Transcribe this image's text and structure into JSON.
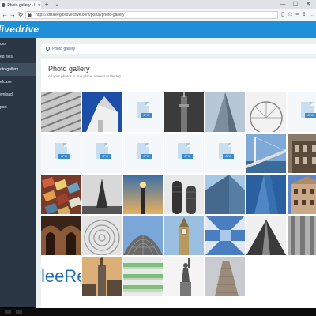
{
  "browser": {
    "tab_title": "Photo gallery - Livedrive",
    "tab_close": "✕",
    "new_tab": "+",
    "tab_menu": "⌄",
    "url": "https://dtzaeeglbi.livedrive.com/portal/photo-gallery",
    "nav": {
      "back": "←",
      "forward": "→",
      "refresh": "↻"
    },
    "window_controls": {
      "minimize": "—",
      "maximize": "☐",
      "close": "✕"
    },
    "toolbar_icons": [
      "reading-view-icon",
      "favorite-star-icon",
      "favorites-icon",
      "notes-icon",
      "share-icon",
      "more-icon"
    ]
  },
  "app": {
    "logo": "livedrive",
    "accent_color": "#1f8fd8",
    "sidebar": [
      {
        "label": "Backups",
        "display": "ces",
        "active": false
      },
      {
        "label": "Shared files",
        "display": "ed files",
        "active": false
      },
      {
        "label": "Photo gallery",
        "display": "oto gallery",
        "active": true
      },
      {
        "label": "Briefcase",
        "display": "efcase",
        "active": false
      },
      {
        "label": "Download",
        "display": "wnload",
        "active": false
      },
      {
        "label": "Support",
        "display": "port",
        "active": false
      }
    ],
    "breadcrumb": "Photo gallery",
    "title": "Photo gallery",
    "subtitle": "All your photos in one place, newest at the top."
  },
  "gallery": {
    "file_badge": "JPG",
    "thumbnails": [
      "photo-building-facade",
      "photo-white-tower-sky",
      "file-jpg",
      "photo-tall-tower",
      "photo-glass-skyscraper",
      "photo-ferris-wheel",
      "file-jpg",
      "file-jpg",
      "file-jpg",
      "file-jpg",
      "file-jpg",
      "file-jpg",
      "photo-bridge",
      "photo-old-building",
      "photo-colorful-blocks",
      "photo-eiffel-tower",
      "photo-industrial-sunset",
      "photo-twin-towers",
      "photo-glass-facade",
      "photo-blue-skyscraper",
      "photo-ornate-building",
      "photo-arched-hall",
      "photo-spiral-dome",
      "photo-geodesic-dome",
      "photo-big-ben",
      "photo-blue-sky-buildings",
      "photo-converging-tower",
      "photo-stone-pillars",
      "photo-logo-text",
      "photo-empire-state",
      "photo-green-balconies",
      "photo-statue-liberty",
      "photo-flatiron"
    ],
    "logo_text": "leeRe"
  }
}
